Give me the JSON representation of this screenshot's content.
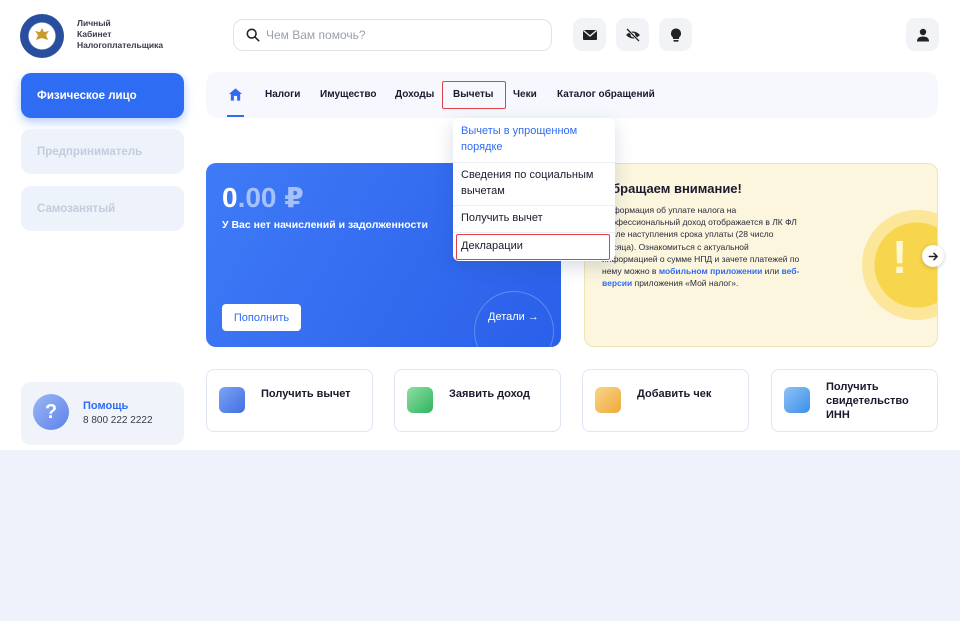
{
  "header": {
    "logo_text": [
      "Личный",
      "Кабинет",
      "Налогоплательщика"
    ],
    "search_placeholder": "Чем Вам помочь?",
    "icons": [
      "mail-icon",
      "eye-off-icon",
      "lightbulb-icon",
      "user-icon"
    ]
  },
  "sidebar": {
    "items": [
      {
        "label": "Физическое лицо",
        "active": true
      },
      {
        "label": "Предприниматель",
        "active": false
      },
      {
        "label": "Самозанятый",
        "active": false
      }
    ],
    "help": {
      "title": "Помощь",
      "phone": "8 800 222 2222",
      "icon": "?"
    }
  },
  "tabs": [
    "Налоги",
    "Имущество",
    "Доходы",
    "Вычеты",
    "Чеки",
    "Каталог обращений"
  ],
  "dropdown": [
    "Вычеты в упрощенном порядке",
    "Сведения по социальным вычетам",
    "Получить вычет",
    "Декларации"
  ],
  "balance": {
    "amount_int": "0",
    "amount_frac": ".00 ₽",
    "description": "У Вас нет начислений и задолженности",
    "topup_label": "Пополнить",
    "details_label": "Детали →"
  },
  "notice": {
    "title": "Обращаем внимание!",
    "body_1": "Информация об уплате налога на профессиональный доход отображается в ЛК ФЛ после наступления срока уплаты (28 число месяца). Ознакомиться с актуальной информацией о сумме НПД и зачете платежей по нему можно в",
    "link_1": "мобильном приложении",
    "body_2": "или",
    "link_2": "веб-версии",
    "body_3": "приложения «Мой налог»."
  },
  "actions": [
    {
      "label": "Получить вычет"
    },
    {
      "label": "Заявить доход"
    },
    {
      "label": "Добавить чек"
    },
    {
      "label": "Получить свидетельство ИНН"
    }
  ],
  "colors": {
    "accent": "#2f6cf4",
    "highlight": "#e0404a",
    "notice_bg": "#fbf6dd"
  }
}
